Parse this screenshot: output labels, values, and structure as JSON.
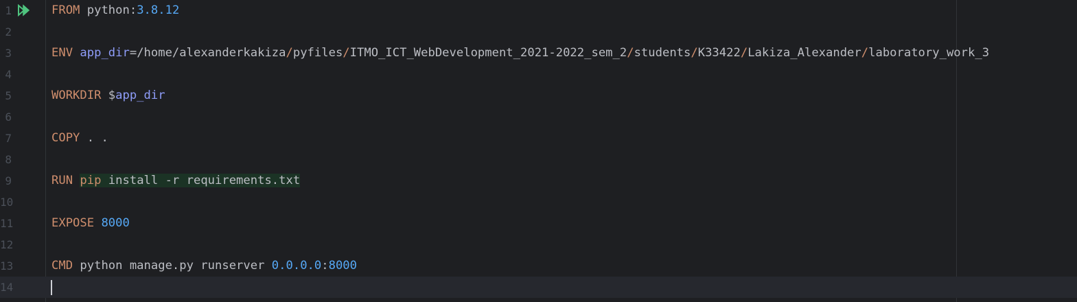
{
  "editor": {
    "colors": {
      "background": "#1e1f22",
      "keyword": "#cf8e6d",
      "number": "#56a8f5",
      "variable": "#8f9df9",
      "text": "#bcbec4",
      "run_icon": "#4fc47f",
      "highlight": "#1b3325"
    },
    "run_icon": "double-play-icon",
    "lines": [
      {
        "number": "1",
        "tokens": [
          "FROM",
          " python:",
          "3.8.12"
        ]
      },
      {
        "number": "2",
        "tokens": []
      },
      {
        "number": "3",
        "tokens": [
          "ENV",
          " ",
          "app_dir",
          "=/home/alexanderkakiza",
          "/",
          "pyfiles",
          "/",
          "ITMO_ICT_WebDevelopment_2021-2022_sem_2",
          "/",
          "students",
          "/",
          "K33422",
          "/",
          "Lakiza_Alexander",
          "/",
          "laboratory_work_3"
        ]
      },
      {
        "number": "4",
        "tokens": []
      },
      {
        "number": "5",
        "tokens": [
          "WORKDIR",
          " $",
          "app_dir"
        ]
      },
      {
        "number": "6",
        "tokens": []
      },
      {
        "number": "7",
        "tokens": [
          "COPY",
          " . ."
        ]
      },
      {
        "number": "8",
        "tokens": []
      },
      {
        "number": "9",
        "tokens": [
          "RUN",
          " ",
          "pip",
          " install -r requirements.txt"
        ]
      },
      {
        "number": "10",
        "tokens": []
      },
      {
        "number": "11",
        "tokens": [
          "EXPOSE",
          " ",
          "8000"
        ]
      },
      {
        "number": "12",
        "tokens": []
      },
      {
        "number": "13",
        "tokens": [
          "CMD",
          " python manage.py runserver ",
          "0.0.0.0",
          ":",
          "8000"
        ]
      },
      {
        "number": "14",
        "tokens": []
      }
    ]
  }
}
